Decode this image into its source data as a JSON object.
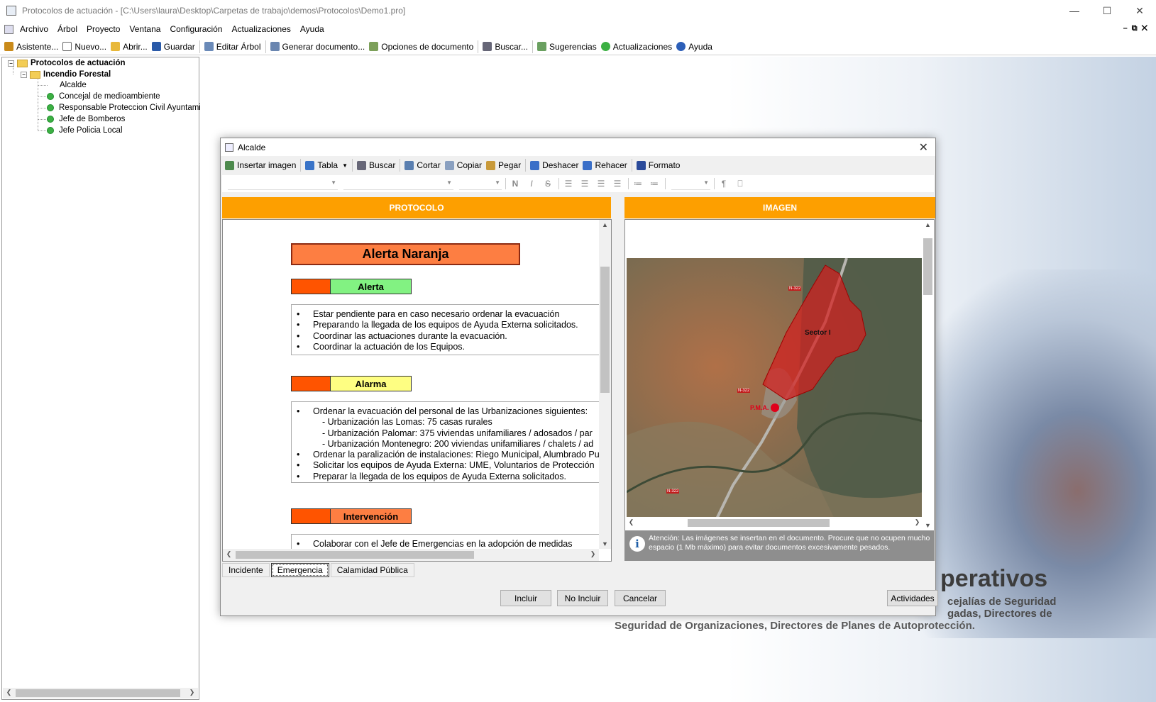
{
  "window": {
    "title": "Protocolos de actuación - [C:\\Users\\laura\\Desktop\\Carpetas de trabajo\\demos\\Protocolos\\Demo1.pro]",
    "minimize": "—",
    "maximize": "☐",
    "close": "✕"
  },
  "menubar": {
    "items": [
      "Archivo",
      "Árbol",
      "Proyecto",
      "Ventana",
      "Configuración",
      "Actualizaciones",
      "Ayuda"
    ],
    "mdi_controls": "–⧉✕"
  },
  "toolbar": {
    "buttons": [
      {
        "label": "Asistente...",
        "icon": "wand-icon",
        "color": "#c98a1a"
      },
      {
        "label": "Nuevo...",
        "icon": "new-document-icon",
        "color": "#ffffff"
      },
      {
        "label": "Abrir...",
        "icon": "open-folder-icon",
        "color": "#e8b83a"
      },
      {
        "label": "Guardar",
        "icon": "save-icon",
        "color": "#2a5aa8"
      },
      {
        "label": "Editar Árbol",
        "icon": "edit-tree-icon",
        "color": "#6a8ab8"
      },
      {
        "label": "Generar documento...",
        "icon": "generate-document-icon",
        "color": "#6a86b0"
      },
      {
        "label": "Opciones de documento",
        "icon": "document-options-icon",
        "color": "#7da05a"
      },
      {
        "label": "Buscar...",
        "icon": "binoculars-icon",
        "color": "#667"
      },
      {
        "label": "Sugerencias",
        "icon": "suggestions-icon",
        "color": "#6aa060"
      },
      {
        "label": "Actualizaciones",
        "icon": "updates-icon",
        "color": "#3cb043"
      },
      {
        "label": "Ayuda",
        "icon": "help-icon",
        "color": "#2c5fb8"
      }
    ]
  },
  "tree": {
    "root": "Protocolos de actuación",
    "child": "Incendio Forestal",
    "leaves": [
      "Alcalde",
      "Concejal de medioambiente",
      "Responsable Proteccion Civil Ayuntamien",
      "Jefe de Bomberos",
      "Jefe Policia Local"
    ]
  },
  "background": {
    "big": "perativos",
    "line1": "cejalías de Seguridad",
    "line2": "gadas, Directores de",
    "line3": "Seguridad de Organizaciones, Directores de Planes de Autoprotección."
  },
  "dialog": {
    "title": "Alcalde",
    "close": "✕",
    "tools": [
      {
        "label": "Insertar imagen",
        "icon": "insert-image-icon",
        "color": "#4d8a4d"
      },
      {
        "label": "Tabla",
        "icon": "table-icon",
        "color": "#3a74c8"
      },
      {
        "label": "Buscar",
        "icon": "binoculars-icon",
        "color": "#667"
      },
      {
        "label": "Cortar",
        "icon": "scissors-icon",
        "color": "#5a7fb0"
      },
      {
        "label": "Copiar",
        "icon": "copy-icon",
        "color": "#8aa0c0"
      },
      {
        "label": "Pegar",
        "icon": "paste-icon",
        "color": "#c99a3a"
      },
      {
        "label": "Deshacer",
        "icon": "undo-icon",
        "color": "#3a6fc8"
      },
      {
        "label": "Rehacer",
        "icon": "redo-icon",
        "color": "#3a6fc8"
      },
      {
        "label": "Formato",
        "icon": "format-icon",
        "color": "#2a4a9a"
      }
    ],
    "format_buttons": [
      "N",
      "I",
      "S"
    ],
    "protocolo_header": "PROTOCOLO",
    "imagen_header": "IMAGEN",
    "alert_title": "Alerta Naranja",
    "sections": [
      {
        "label": "Alerta",
        "color": "#82f282",
        "items": [
          "Estar pendiente para en caso necesario ordenar la evacuación",
          "Preparando la llegada de los equipos de Ayuda Externa solicitados.",
          "Coordinar las actuaciones durante la evacuación.",
          "Coordinar la actuación de los Equipos."
        ]
      },
      {
        "label": "Alarma",
        "color": "#fefe82",
        "items": [
          "Ordenar la evacuación del personal de las Urbanizaciones siguientes:",
          "- Urbanización las Lomas:  75 casas rurales",
          "- Urbanización Palomar:   375 viviendas unifamiliares / adosados / par",
          "- Urbanización Montenegro:  200 viviendas unifamiliares / chalets / ad",
          "Ordenar la paralización de instalaciones: Riego Municipal, Alumbrado Pu",
          "Solicitar los equipos de Ayuda Externa: UME, Voluntarios de Protección",
          "Preparar la llegada de los equipos de Ayuda Externa solicitados."
        ]
      },
      {
        "label": "Intervención",
        "color": "#fd7e42",
        "items": [
          "Colaborar con el Jefe de Emergencias en la adopción de medidas"
        ]
      }
    ],
    "map_labels": {
      "sector": "Sector I",
      "pma": "P.M.A.",
      "road1": "N-322",
      "road2": "N-322",
      "road3": "N-322"
    },
    "info_text": "Atención: Las imágenes se insertan en el documento. Procure que no ocupen mucho espacio (1 Mb máximo) para evitar documentos excesivamente pesados.",
    "tabs": [
      "Incidente",
      "Emergencia",
      "Calamidad Pública"
    ],
    "selected_tab": "Emergencia",
    "buttons": {
      "incluir": "Incluir",
      "no_incluir": "No Incluir",
      "cancelar": "Cancelar",
      "actividades": "Actividades"
    }
  }
}
